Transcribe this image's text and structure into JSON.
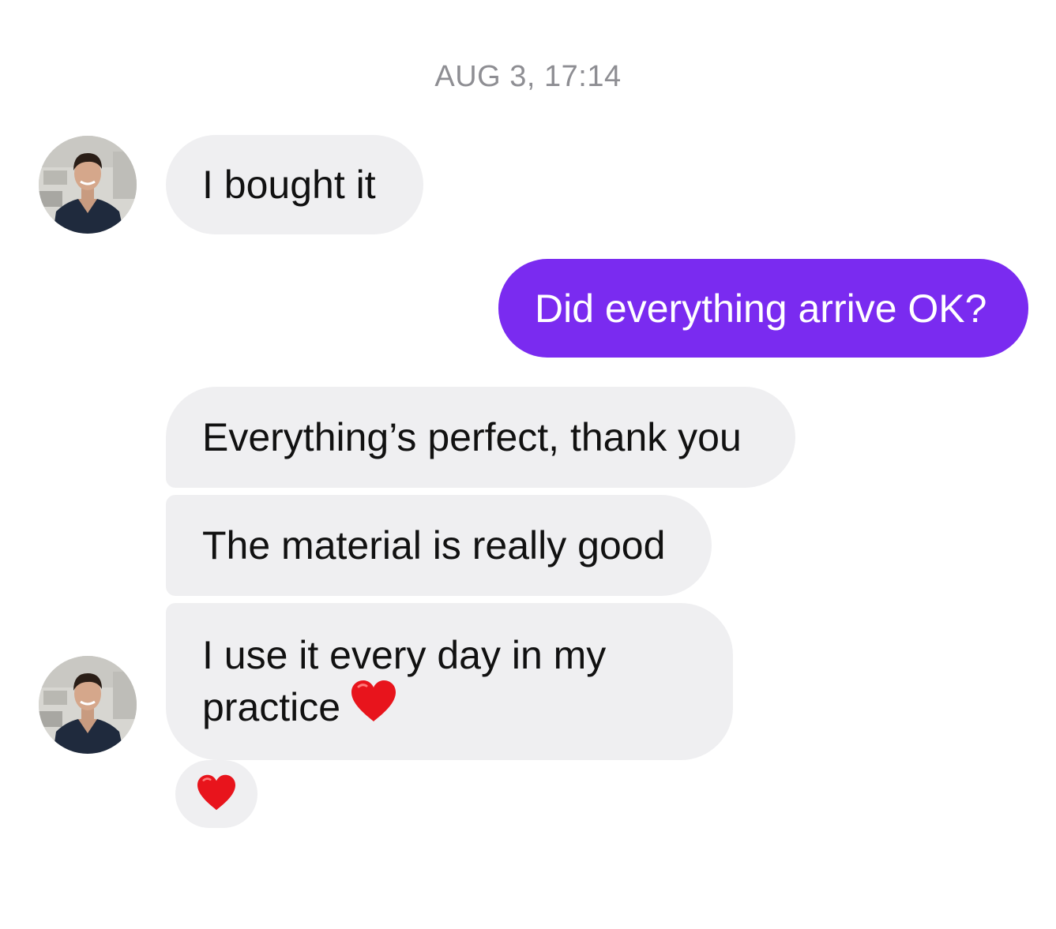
{
  "conversation": {
    "timestamp": "AUG 3, 17:14",
    "messages": [
      {
        "sender": "contact",
        "text": "I bought it"
      },
      {
        "sender": "me",
        "text": "Did everything arrive OK?"
      },
      {
        "sender": "contact",
        "text": "Everything’s perfect, thank you"
      },
      {
        "sender": "contact",
        "text": "The material is really good"
      },
      {
        "sender": "contact",
        "line1": "I use it every day in my",
        "line2": "practice",
        "emoji": "heart-icon"
      }
    ],
    "reaction": {
      "emoji": "heart-icon"
    }
  },
  "colors": {
    "outgoing_bubble": "#7a2bf0",
    "incoming_bubble": "#efeff1",
    "timestamp_text": "#8e8e93",
    "heart": "#e8141c"
  }
}
